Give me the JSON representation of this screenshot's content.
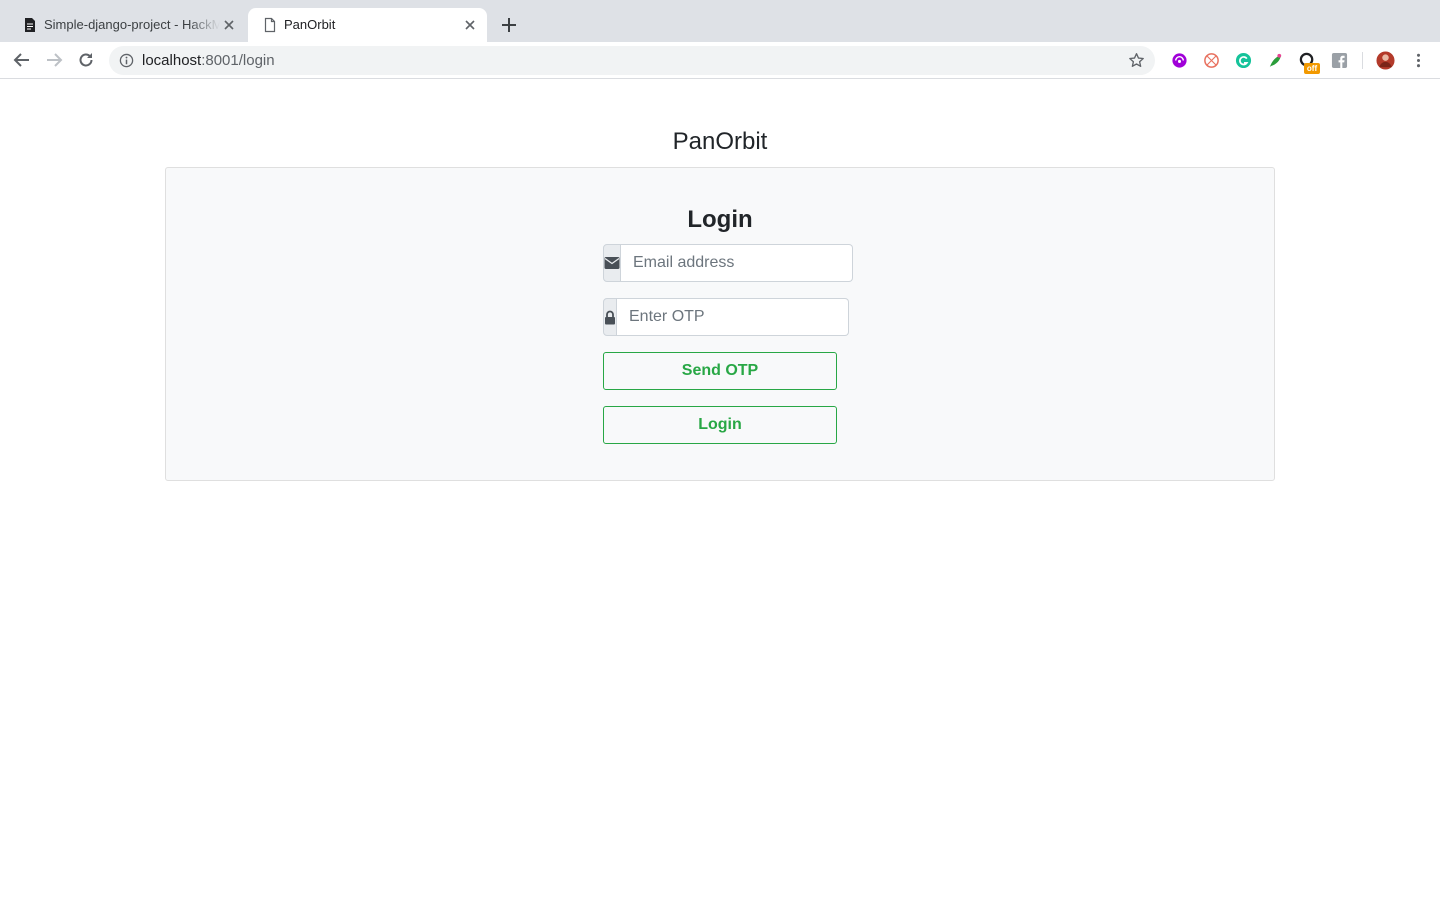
{
  "browser": {
    "tabs": [
      {
        "title": "Simple-django-project - HackMD",
        "active": false
      },
      {
        "title": "PanOrbit",
        "active": true
      }
    ],
    "url_host": "localhost",
    "url_path": ":8001/login",
    "extension_badge": "off"
  },
  "page": {
    "brand": "PanOrbit",
    "login_title": "Login",
    "email_placeholder": "Email address",
    "otp_placeholder": "Enter OTP",
    "send_otp_label": "Send OTP",
    "login_label": "Login"
  },
  "colors": {
    "accent_success": "#28a745",
    "panel_bg": "#f8f9fa",
    "tabstrip_bg": "#dee1e6"
  }
}
